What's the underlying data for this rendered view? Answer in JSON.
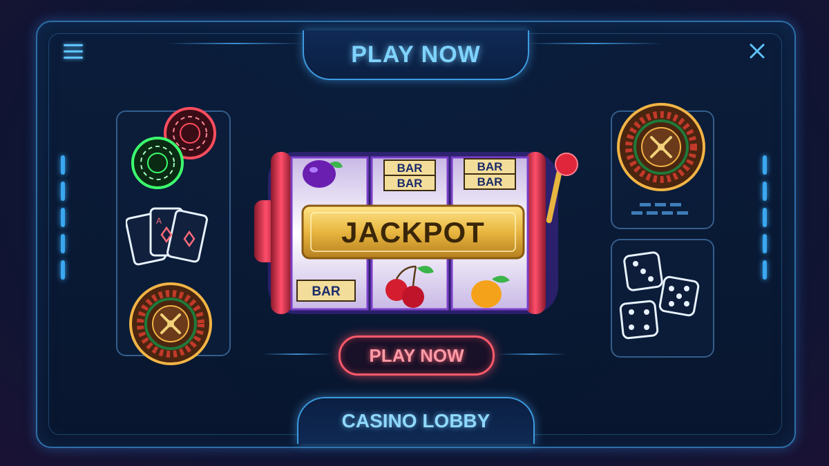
{
  "header": {
    "title": "PLAY NOW"
  },
  "slot_machine": {
    "banner": "JACKPOT",
    "reel_symbols": {
      "reel1_top": "plum",
      "reel1_bottom": "BAR",
      "reel2_top": [
        "BAR",
        "BAR"
      ],
      "reel2_bottom": "cherries",
      "reel3_top": [
        "BAR",
        "BAR"
      ],
      "reel3_bottom": "orange"
    }
  },
  "play_button": {
    "label": "PLAY NOW"
  },
  "footer": {
    "label": "CASINO LOBBY"
  },
  "left_panel": {
    "icons": [
      "poker-chips-icon",
      "playing-cards-icon",
      "roulette-wheel-icon"
    ]
  },
  "right_panels": {
    "icons": [
      "roulette-wheel-icon",
      "dice-icon"
    ]
  },
  "colors": {
    "accent": "#3d9be0",
    "title_glow": "#7fd3ff",
    "button_red": "#ff5a6a",
    "gold": "#e8b640",
    "background": "#0b1632"
  }
}
